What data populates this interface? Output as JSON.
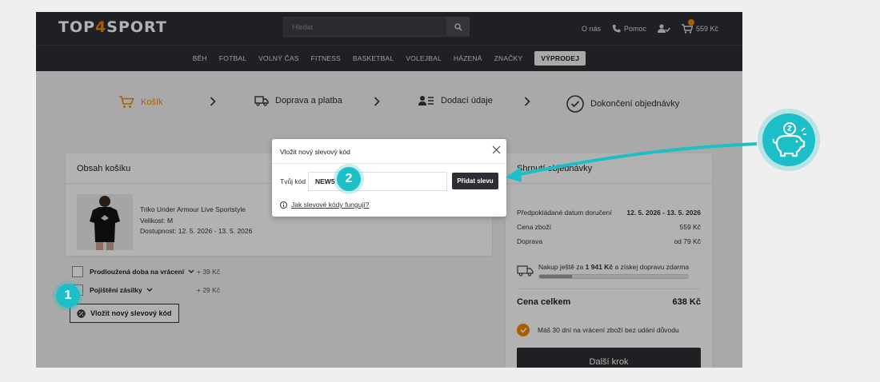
{
  "brand": {
    "logo_prefix": "TOP",
    "logo_four": "4",
    "logo_suffix": "SPORT"
  },
  "header": {
    "search_placeholder": "Hledat",
    "links": {
      "about": "O nás",
      "help": "Pomoc"
    },
    "cart_total": "559 Kč"
  },
  "nav": {
    "items": [
      "BĚH",
      "FOTBAL",
      "VOLNÝ ČAS",
      "FITNESS",
      "BASKETBAL",
      "VOLEJBAL",
      "HÁZENÁ",
      "ZNAČKY"
    ],
    "sale": "VÝPRODEJ"
  },
  "steps": [
    "Košík",
    "Doprava a platba",
    "Dodací údaje",
    "Dokončení objednávky"
  ],
  "cart": {
    "title": "Obsah košíku",
    "product": {
      "name": "Triko Under Armour Live Sportstyle",
      "size": "Velikost: M",
      "availability": "Dostupnost:  12. 5. 2026 - 13. 5. 2026"
    },
    "addons": [
      {
        "name": "Prodloužená doba na vrácení",
        "price": "+ 39 Kč"
      },
      {
        "name": "Pojištění zásilky",
        "price": "+ 29 Kč"
      }
    ],
    "discount_button": "Vložit nový slevový kód"
  },
  "summary": {
    "title": "Shrnutí objednávky",
    "rows": [
      {
        "label": "Předpokládané datum doručení",
        "value": "12. 5. 2026 - 13. 5. 2026"
      },
      {
        "label": "Cena zboží",
        "value": "559 Kč"
      },
      {
        "label": "Doprava",
        "value": "od 79 Kč"
      }
    ],
    "free_shipping_prefix": "Nakup ještě za ",
    "free_shipping_amount": "1 941 Kč",
    "free_shipping_suffix": " a získej dopravu zdarma",
    "free_shipping_progress": 0.22,
    "total_label": "Cena celkem",
    "total_value": "638 Kč",
    "return_note": "Máš 30 dní na vrácení zboží bez udání důvodu",
    "next_button": "Další krok"
  },
  "modal": {
    "title": "Vložit nový slevový kód",
    "label": "Tvůj kód",
    "code_value": "NEW5",
    "add_button": "Přidat slevu",
    "help_link": "Jak slevové kódy fungují?"
  },
  "annotations": {
    "marker1": "1",
    "marker2": "2"
  },
  "colors": {
    "accent": "#f08a00",
    "dark": "#2c2e33",
    "teal": "#1cbfc7"
  }
}
